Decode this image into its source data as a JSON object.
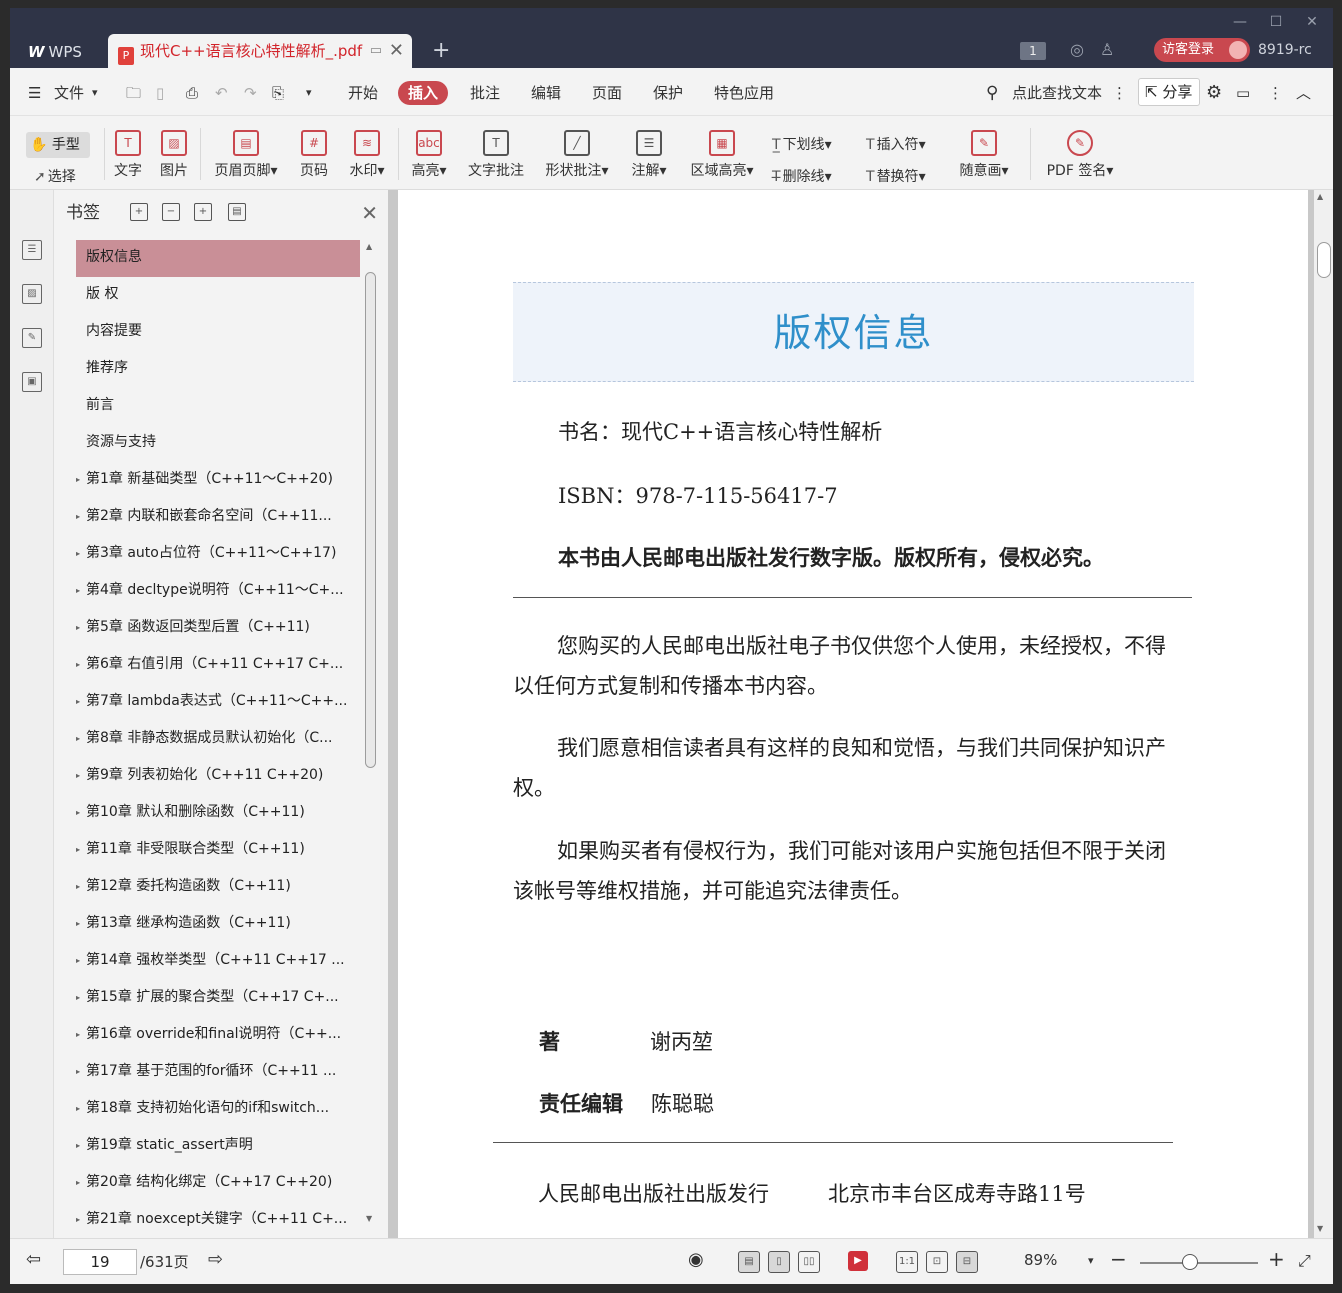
{
  "titlebar": {
    "app_tab": "WPS",
    "app_logo": "W",
    "doc_tab": "现代C++语言核心特性解析_.pdf",
    "pdf_badge": "P",
    "doc_count": "1",
    "login": "访客登录",
    "version": "8919-rc",
    "new_tab": "+",
    "close_tab": "✕"
  },
  "menubar": {
    "file": "文件",
    "items": [
      "开始",
      "插入",
      "批注",
      "编辑",
      "页面",
      "保护",
      "特色应用"
    ],
    "active": "插入",
    "search": "点此查找文本",
    "share": "分享"
  },
  "ribbon": {
    "hand": "手型",
    "select": "选择",
    "text": "文字",
    "picture": "图片",
    "header_footer": "页眉页脚",
    "page_number": "页码",
    "watermark": "水印",
    "highlight": "高亮",
    "highlight_icon": "abc",
    "text_note": "文字批注",
    "shape_note": "形状批注",
    "annotation": "注解",
    "area_highlight": "区域高亮",
    "underline": "下划线",
    "strikethrough": "删除线",
    "insert_mark": "插入符",
    "replace_mark": "替换符",
    "freehand": "随意画",
    "pdf_sign": "PDF 签名"
  },
  "bookmarks": {
    "title": "书签",
    "items": [
      {
        "label": "版权信息",
        "expandable": false,
        "selected": true
      },
      {
        "label": "版 权",
        "expandable": false
      },
      {
        "label": "内容提要",
        "expandable": false
      },
      {
        "label": "推荐序",
        "expandable": false
      },
      {
        "label": "前言",
        "expandable": false
      },
      {
        "label": "资源与支持",
        "expandable": false
      },
      {
        "label": "第1章 新基础类型（C++11～C++20)",
        "expandable": true
      },
      {
        "label": "第2章 内联和嵌套命名空间（C++11...",
        "expandable": true
      },
      {
        "label": "第3章 auto占位符（C++11～C++17)",
        "expandable": true
      },
      {
        "label": "第4章 decltype说明符（C++11～C+...",
        "expandable": true
      },
      {
        "label": "第5章 函数返回类型后置（C++11)",
        "expandable": true
      },
      {
        "label": "第6章 右值引用（C++11 C++17 C+...",
        "expandable": true
      },
      {
        "label": "第7章 lambda表达式（C++11～C++...",
        "expandable": true
      },
      {
        "label": "第8章 非静态数据成员默认初始化（C...",
        "expandable": true
      },
      {
        "label": "第9章 列表初始化（C++11 C++20)",
        "expandable": true
      },
      {
        "label": "第10章 默认和删除函数（C++11)",
        "expandable": true
      },
      {
        "label": "第11章 非受限联合类型（C++11)",
        "expandable": true
      },
      {
        "label": "第12章 委托构造函数（C++11)",
        "expandable": true
      },
      {
        "label": "第13章 继承构造函数（C++11)",
        "expandable": true
      },
      {
        "label": "第14章 强枚举类型（C++11 C++17 ...",
        "expandable": true
      },
      {
        "label": "第15章 扩展的聚合类型（C++17 C+...",
        "expandable": true
      },
      {
        "label": "第16章 override和final说明符（C++...",
        "expandable": true
      },
      {
        "label": "第17章 基于范围的for循环（C++11 ...",
        "expandable": true
      },
      {
        "label": "第18章 支持初始化语句的if和switch...",
        "expandable": true
      },
      {
        "label": "第19章 static_assert声明",
        "expandable": true
      },
      {
        "label": "第20章 结构化绑定（C++17 C++20)",
        "expandable": true
      },
      {
        "label": "第21章 noexcept关键字（C++11 C+...",
        "expandable": true
      }
    ]
  },
  "page": {
    "title": "版权信息",
    "book_name": "书名：现代C++语言核心特性解析",
    "isbn": "ISBN：978-7-115-56417-7",
    "rights": "本书由人民邮电出版社发行数字版。版权所有，侵权必究。",
    "para1": "您购买的人民邮电出版社电子书仅供您个人使用，未经授权，不得以任何方式复制和传播本书内容。",
    "para2": "我们愿意相信读者具有这样的良知和觉悟，与我们共同保护知识产权。",
    "para3": "如果购买者有侵权行为，我们可能对该用户实施包括但不限于关闭该帐号等维权措施，并可能追究法律责任。",
    "author_label": "著",
    "author": "谢丙堃",
    "editor_label": "责任编辑",
    "editor": "陈聪聪",
    "publisher": "人民邮电出版社出版发行",
    "address": "北京市丰台区成寿寺路11号"
  },
  "status": {
    "current_page": "19",
    "total_pages": "/631页",
    "zoom": "89%"
  },
  "colors": {
    "accent": "#c9484f",
    "titlebar": "#2f3447",
    "title_blue": "#2f8fca",
    "bookmark_selected": "#c98f97"
  }
}
